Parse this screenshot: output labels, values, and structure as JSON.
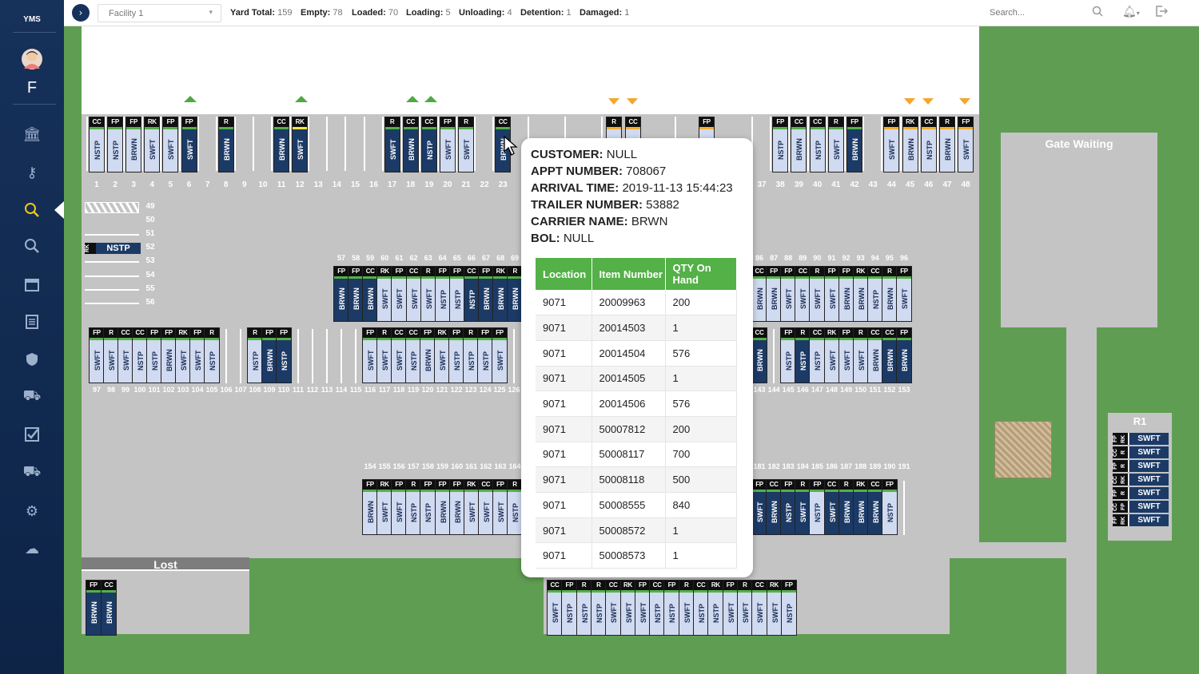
{
  "app": {
    "logo": "YMS",
    "user_initial": "F"
  },
  "topbar": {
    "facility": "Facility 1",
    "stats": [
      {
        "label": "Yard Total:",
        "value": "159"
      },
      {
        "label": "Empty:",
        "value": "78"
      },
      {
        "label": "Loaded:",
        "value": "70"
      },
      {
        "label": "Loading:",
        "value": "5"
      },
      {
        "label": "Unloading:",
        "value": "4"
      },
      {
        "label": "Detention:",
        "value": "1"
      },
      {
        "label": "Damaged:",
        "value": "1"
      }
    ],
    "search_placeholder": "Search..."
  },
  "sidebar": {
    "icons": [
      "bank-icon",
      "key-icon",
      "search-yard-icon",
      "search-icon",
      "calendar-icon",
      "document-icon",
      "shield-icon",
      "truck-fast-icon",
      "checkbox-icon",
      "truck-icon",
      "gear-icon",
      "cloud-upload-icon"
    ]
  },
  "yard": {
    "gate_waiting": "Gate Waiting",
    "lost": "Lost",
    "r1": "R1",
    "top_row": [
      {
        "n": "1",
        "code": "CC",
        "carrier": "NSTP"
      },
      {
        "n": "2",
        "code": "FP",
        "carrier": "NSTP"
      },
      {
        "n": "3",
        "code": "FP",
        "carrier": "BRWN"
      },
      {
        "n": "4",
        "code": "RK",
        "carrier": "SWFT"
      },
      {
        "n": "5",
        "code": "FP",
        "carrier": "SWFT"
      },
      {
        "n": "6",
        "code": "FP",
        "carrier": "SWFT"
      },
      {
        "n": "7"
      },
      {
        "n": "8",
        "code": "R",
        "carrier": "BRWN"
      },
      {
        "n": "9"
      },
      {
        "n": "10"
      },
      {
        "n": "11",
        "code": "CC",
        "carrier": "BRWN"
      },
      {
        "n": "12",
        "code": "RK",
        "carrier": "SWFT"
      },
      {
        "n": "13"
      },
      {
        "n": "14"
      },
      {
        "n": "15"
      },
      {
        "n": "16"
      },
      {
        "n": "17",
        "code": "R",
        "carrier": "SWFT"
      },
      {
        "n": "18",
        "code": "CC",
        "carrier": "BRWN"
      },
      {
        "n": "19",
        "code": "CC",
        "carrier": "NSTP"
      },
      {
        "n": "20",
        "code": "FP",
        "carrier": "SWFT"
      },
      {
        "n": "21",
        "code": "R",
        "carrier": "SWFT"
      },
      {
        "n": "22"
      },
      {
        "n": "23",
        "code": "CC",
        "carrier": "BRWN"
      }
    ],
    "top_row_right": [
      {
        "n": "37"
      },
      {
        "n": "38",
        "code": "FP",
        "carrier": "NSTP"
      },
      {
        "n": "39",
        "code": "CC",
        "carrier": "BRWN"
      },
      {
        "n": "40",
        "code": "CC",
        "carrier": "NSTP"
      },
      {
        "n": "41",
        "code": "R",
        "carrier": "SWFT"
      },
      {
        "n": "42",
        "code": "FP",
        "carrier": "BRWN"
      },
      {
        "n": "43"
      },
      {
        "n": "44",
        "code": "FP",
        "carrier": "SWFT"
      },
      {
        "n": "45",
        "code": "RK",
        "carrier": "BRWN"
      },
      {
        "n": "46",
        "code": "CC",
        "carrier": "NSTP"
      },
      {
        "n": "47",
        "code": "R",
        "carrier": "BRWN"
      },
      {
        "n": "48",
        "code": "FP",
        "carrier": "SWFT"
      }
    ],
    "side_slots": [
      "49",
      "50",
      "51",
      "52",
      "53",
      "54",
      "55",
      "56"
    ],
    "slot52_code": "RK",
    "slot52_carrier": "NSTP",
    "row_57": {
      "nums": [
        "57",
        "58",
        "59",
        "60",
        "61",
        "62",
        "63",
        "64",
        "65",
        "66",
        "67",
        "68",
        "69"
      ],
      "codes": [
        "FP",
        "FP",
        "CC",
        "RK",
        "FP",
        "CC",
        "R",
        "FP",
        "FP",
        "CC",
        "FP",
        "RK",
        "R"
      ],
      "carriers": [
        "BRWN",
        "BRWN",
        "BRWN",
        "SWFT",
        "SWFT",
        "SWFT",
        "SWFT",
        "NSTP",
        "NSTP",
        "NSTP",
        "BRWN",
        "BRWN",
        "BRWN"
      ]
    },
    "row_86": {
      "nums": [
        "86",
        "87",
        "88",
        "89",
        "90",
        "91",
        "92",
        "93",
        "94",
        "95",
        "96"
      ],
      "codes": [
        "CC",
        "FP",
        "FP",
        "CC",
        "R",
        "FP",
        "FP",
        "RK",
        "CC",
        "R",
        "FP"
      ],
      "carriers": [
        "BRWN",
        "BRWN",
        "SWFT",
        "SWFT",
        "SWFT",
        "SWFT",
        "BRWN",
        "BRWN",
        "NSTP",
        "BRWN",
        "SWFT"
      ]
    },
    "row_97": {
      "nums": [
        "97",
        "98",
        "99",
        "100",
        "101",
        "102",
        "103",
        "104",
        "105",
        "106",
        "107",
        "108",
        "109",
        "110",
        "111",
        "112",
        "113",
        "114",
        "115",
        "116",
        "117",
        "118",
        "119",
        "120",
        "121",
        "122",
        "123",
        "124",
        "125",
        "126"
      ],
      "codes": [
        "FP",
        "R",
        "CC",
        "CC",
        "FP",
        "FP",
        "RK",
        "FP",
        "R",
        "",
        "",
        "R",
        "FP",
        "FP",
        "",
        "",
        "",
        "",
        "",
        "FP",
        "R",
        "CC",
        "CC",
        "FP",
        "RK",
        "FP",
        "R",
        "FP",
        "FP",
        ""
      ],
      "carriers": [
        "SWFT",
        "SWFT",
        "SWFT",
        "NSTP",
        "NSTP",
        "BRWN",
        "SWFT",
        "SWFT",
        "NSTP",
        "",
        "",
        "NSTP",
        "BRWN",
        "NSTP",
        "",
        "",
        "",
        "",
        "",
        "SWFT",
        "SWFT",
        "SWFT",
        "NSTP",
        "BRWN",
        "SWFT",
        "NSTP",
        "NSTP",
        "NSTP",
        "SWFT",
        ""
      ]
    },
    "row_143": {
      "nums": [
        "143",
        "144",
        "145",
        "146",
        "147",
        "148",
        "149",
        "150",
        "151",
        "152",
        "153"
      ],
      "codes": [
        "CC",
        "",
        "FP",
        "R",
        "CC",
        "RK",
        "FP",
        "R",
        "CC",
        "CC",
        "FP"
      ],
      "carriers": [
        "BRWN",
        "",
        "NSTP",
        "NSTP",
        "NSTP",
        "SWFT",
        "SWFT",
        "SWFT",
        "BRWN",
        "BRWN",
        "BRWN"
      ]
    },
    "row_154": {
      "nums": [
        "154",
        "155",
        "156",
        "157",
        "158",
        "159",
        "160",
        "161",
        "162",
        "163",
        "164"
      ],
      "codes": [
        "FP",
        "RK",
        "FP",
        "R",
        "FP",
        "FP",
        "FP",
        "RK",
        "CC",
        "FP",
        "R"
      ],
      "carriers": [
        "BRWN",
        "SWFT",
        "SWFT",
        "NSTP",
        "NSTP",
        "BRWN",
        "BRWN",
        "SWFT",
        "SWFT",
        "SWFT",
        "NSTP"
      ]
    },
    "row_181": {
      "nums": [
        "181",
        "182",
        "183",
        "184",
        "185",
        "186",
        "187",
        "188",
        "189",
        "190",
        "191"
      ],
      "codes": [
        "FP",
        "CC",
        "FP",
        "R",
        "FP",
        "CC",
        "R",
        "RK",
        "CC",
        "FP",
        ""
      ],
      "carriers": [
        "SWFT",
        "BRWN",
        "NSTP",
        "SWFT",
        "NSTP",
        "SWFT",
        "BRWN",
        "BRWN",
        "BRWN",
        "NSTP",
        ""
      ]
    },
    "bottom_row": {
      "codes": [
        "CC",
        "FP",
        "R",
        "R",
        "CC",
        "RK",
        "FP",
        "CC",
        "FP",
        "R",
        "CC",
        "RK",
        "FP",
        "R",
        "CC",
        "RK",
        "FP"
      ],
      "carriers": [
        "SWFT",
        "NSTP",
        "NSTP",
        "NSTP",
        "SWFT",
        "SWFT",
        "SWFT",
        "NSTP",
        "NSTP",
        "SWFT",
        "NSTP",
        "NSTP",
        "SWFT",
        "SWFT",
        "SWFT",
        "SWFT",
        "NSTP"
      ]
    },
    "lost_trailers": [
      {
        "code": "FP",
        "carrier": "BRWN"
      },
      {
        "code": "CC",
        "carrier": "BRWN"
      }
    ],
    "r1_rows": [
      {
        "a": "FP",
        "b": "RK",
        "carrier": "SWFT"
      },
      {
        "a": "CC",
        "b": "R",
        "carrier": "SWFT"
      },
      {
        "a": "FP",
        "b": "R",
        "carrier": "SWFT"
      },
      {
        "a": "CC",
        "b": "RK",
        "carrier": "SWFT"
      },
      {
        "a": "FP",
        "b": "R",
        "carrier": "SWFT"
      },
      {
        "a": "CC",
        "b": "FP",
        "carrier": "SWFT"
      },
      {
        "a": "FP",
        "b": "RK",
        "carrier": "SWFT"
      }
    ]
  },
  "tooltip": {
    "customer_label": "CUSTOMER:",
    "customer": "NULL",
    "appt_label": "APPT NUMBER:",
    "appt": "708067",
    "arrival_label": "ARRIVAL TIME:",
    "arrival": "2019-11-13 15:44:23",
    "trailer_label": "TRAILER NUMBER:",
    "trailer": "53882",
    "carrier_label": "CARRIER NAME:",
    "carrier": "BRWN",
    "bol_label": "BOL:",
    "bol": "NULL",
    "columns": [
      "Location",
      "Item Number",
      "QTY On Hand"
    ],
    "rows": [
      [
        "9071",
        "20009963",
        "200"
      ],
      [
        "9071",
        "20014503",
        "1"
      ],
      [
        "9071",
        "20014504",
        "576"
      ],
      [
        "9071",
        "20014505",
        "1"
      ],
      [
        "9071",
        "20014506",
        "576"
      ],
      [
        "9071",
        "50007812",
        "200"
      ],
      [
        "9071",
        "50008117",
        "700"
      ],
      [
        "9071",
        "50008118",
        "500"
      ],
      [
        "9071",
        "50008555",
        "840"
      ],
      [
        "9071",
        "50008572",
        "1"
      ],
      [
        "9071",
        "50008573",
        "1"
      ]
    ]
  },
  "colors": {
    "sidebar": "#16315a",
    "yard": "#c4c4c4",
    "grass": "#5f9e52",
    "accent": "#53b147",
    "active_icon": "#f4c515"
  }
}
